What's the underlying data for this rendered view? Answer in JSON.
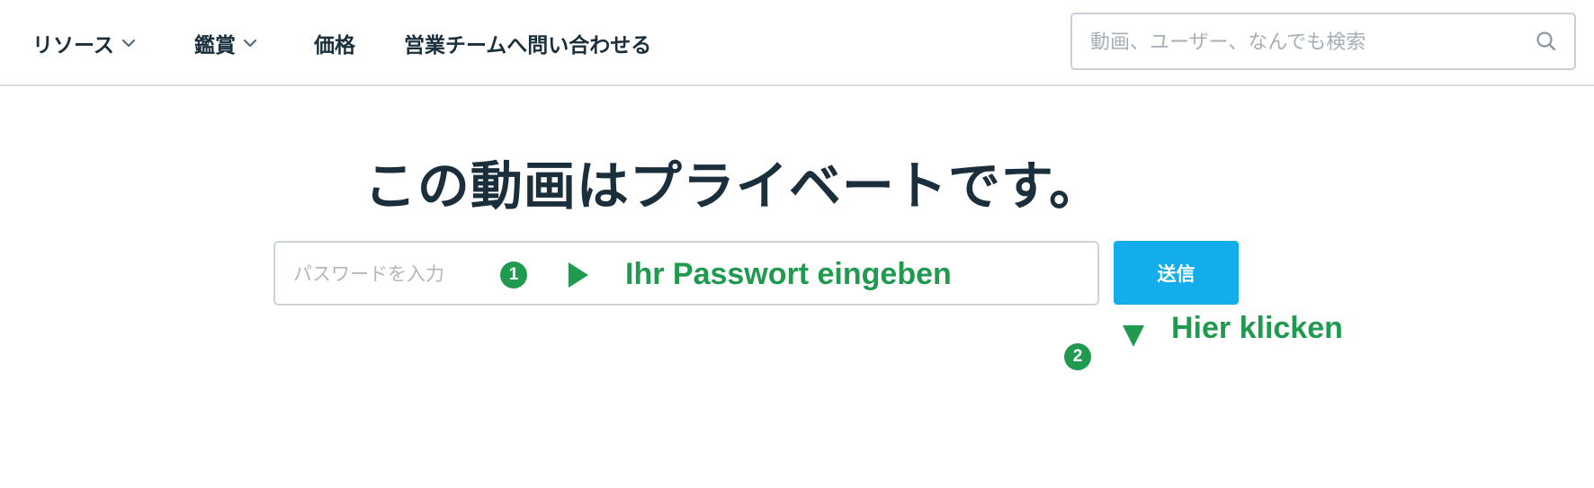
{
  "nav": {
    "resources": "リソース",
    "viewing": "鑑賞",
    "pricing": "価格",
    "contact_sales": "営業チームへ問い合わせる"
  },
  "search": {
    "placeholder": "動画、ユーザー、なんでも検索",
    "value": ""
  },
  "main": {
    "title": "この動画はプライベートです。",
    "password_placeholder": "パスワードを入力",
    "password_value": "",
    "submit_label": "送信"
  },
  "annotations": {
    "step1_number": "1",
    "step1_text": "Ihr Passwort eingeben",
    "step2_number": "2",
    "step2_text": "Hier klicken",
    "color": "#1f9a4e"
  },
  "colors": {
    "text_dark": "#1a2e3b",
    "button_bg": "#13adeb",
    "border": "#cdd4d9"
  },
  "icons": {
    "search": "search-icon",
    "dropdown": "chevron-down-icon",
    "arrow": "triangle-arrow-icon"
  }
}
